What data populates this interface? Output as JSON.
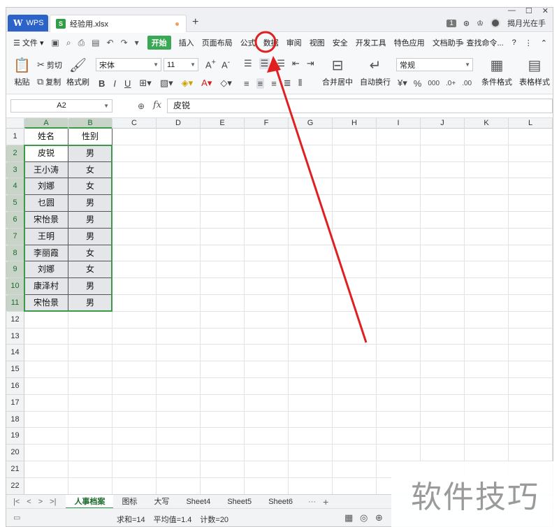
{
  "titlebar": {
    "wps_tab": "WPS",
    "file_tab": "经验用.xlsx",
    "new_tab": "+",
    "badge": "1",
    "user": "揭月光在手"
  },
  "menu": {
    "file": "文件",
    "items": [
      "开始",
      "插入",
      "页面布局",
      "公式",
      "数据",
      "审阅",
      "视图",
      "安全",
      "开发工具",
      "特色应用",
      "文档助手"
    ],
    "search": "查找命令..."
  },
  "ribbon": {
    "paste": "粘贴",
    "cut": "剪切",
    "copy": "复制",
    "format_painter": "格式刷",
    "font_name": "宋体",
    "font_size": "11",
    "merge_center": "合并居中",
    "wrap_text": "自动换行",
    "number_format": "常规",
    "cond_format": "条件格式",
    "table_style": "表格样式"
  },
  "formula_bar": {
    "name_box": "A2",
    "fx": "fx",
    "content": "皮锐"
  },
  "grid": {
    "columns": [
      "A",
      "B",
      "C",
      "D",
      "E",
      "F",
      "G",
      "H",
      "I",
      "J",
      "K",
      "L"
    ],
    "rows": [
      "1",
      "2",
      "3",
      "4",
      "5",
      "6",
      "7",
      "8",
      "9",
      "10",
      "11",
      "12",
      "13",
      "14",
      "15",
      "16",
      "17",
      "18",
      "19",
      "20",
      "21",
      "22"
    ],
    "table": [
      [
        "姓名",
        "性别"
      ],
      [
        "皮锐",
        "男"
      ],
      [
        "王小涛",
        "女"
      ],
      [
        "刘娜",
        "女"
      ],
      [
        "乜圆",
        "男"
      ],
      [
        "宋怡景",
        "男"
      ],
      [
        "王明",
        "男"
      ],
      [
        "李丽霞",
        "女"
      ],
      [
        "刘娜",
        "女"
      ],
      [
        "康泽村",
        "男"
      ],
      [
        "宋怡景",
        "男"
      ]
    ]
  },
  "sheets": [
    "人事档案",
    "图标",
    "大写",
    "Sheet4",
    "Sheet5",
    "Sheet6"
  ],
  "status": {
    "sum": "求和=14",
    "avg": "平均值=1.4",
    "count": "计数=20"
  },
  "watermark": "软件技巧",
  "colors": {
    "accent": "#3aa855",
    "annotation": "#e02020",
    "wps_blue": "#2b63c9"
  }
}
